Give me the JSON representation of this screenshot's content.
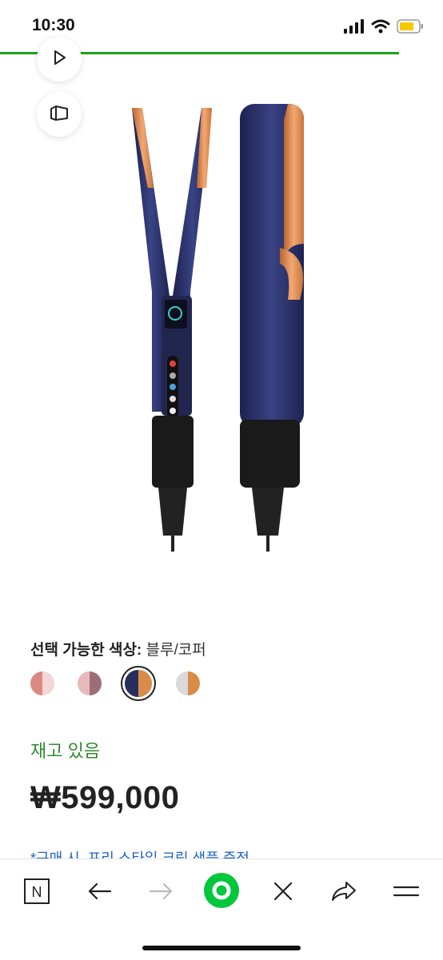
{
  "status": {
    "time": "10:30"
  },
  "page": {
    "load_progress": 0.9
  },
  "product": {
    "color_label_prefix": "선택 가능한 색상:",
    "color_value": "블루/코퍼",
    "swatches": [
      {
        "name": "pink-rose",
        "left": "#d98b83",
        "right": "#f3d6d6",
        "selected": false
      },
      {
        "name": "rose-mauve",
        "left": "#e6b9bd",
        "right": "#9c6f78",
        "selected": false
      },
      {
        "name": "blue-copper",
        "left": "#272f5c",
        "right": "#d98b4a",
        "selected": true
      },
      {
        "name": "silver-copper",
        "left": "#d9d9d9",
        "right": "#d98b4a",
        "selected": false
      }
    ],
    "stock_text": "재고 있음",
    "price": "₩599,000",
    "promo_text": "*구매 시, 프리 스타일 크림 샘플 증정"
  },
  "icons": {
    "video": "play-icon",
    "gallery": "gallery-icon",
    "naver": "naver-n-icon",
    "back": "arrow-left-icon",
    "forward": "arrow-right-icon",
    "green_dot": "green-dot-icon",
    "close": "close-icon",
    "share": "share-icon",
    "menu": "menu-icon"
  },
  "colors": {
    "accent_green": "#00c73c",
    "stock_green": "#2f8a2f",
    "promo_blue": "#1f63c8",
    "progress_green": "#1aa31a"
  }
}
